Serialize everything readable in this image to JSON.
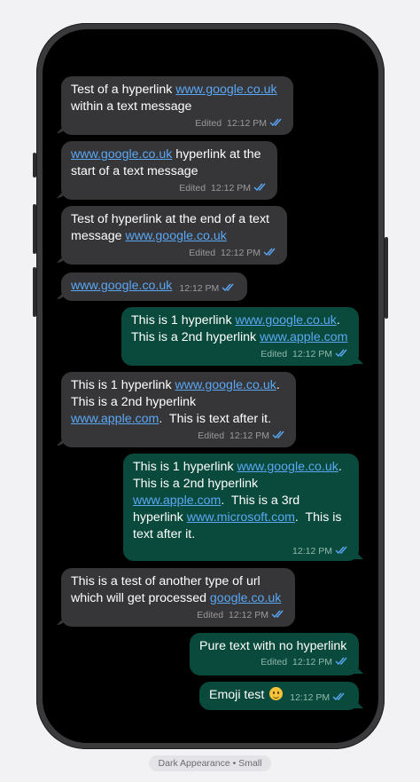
{
  "caption": "Dark Appearance • Small",
  "colors": {
    "incoming_bubble": "#363638",
    "outgoing_bubble": "#0a4a3c",
    "link": "#5aa7f5",
    "read_ticks": "#5aa7f5"
  },
  "messages": [
    {
      "direction": "incoming",
      "lines": [
        [
          "Test of a hyperlink ",
          "@www.google.co.uk"
        ],
        [
          "within a text message"
        ]
      ],
      "edited": "Edited",
      "time": "12:12 PM",
      "status_icon": "double-check-icon"
    },
    {
      "direction": "incoming",
      "lines": [
        [
          "@www.google.co.uk",
          " hyperlink at the"
        ],
        [
          "start of a text message"
        ]
      ],
      "edited": "Edited",
      "time": "12:12 PM",
      "status_icon": "double-check-icon"
    },
    {
      "direction": "incoming",
      "lines": [
        [
          "Test of hyperlink at the end of a text"
        ],
        [
          "message ",
          "@www.google.co.uk"
        ]
      ],
      "edited": "Edited",
      "time": "12:12 PM",
      "status_icon": "double-check-icon"
    },
    {
      "direction": "incoming",
      "lines": [
        [
          "@www.google.co.uk"
        ]
      ],
      "edited": "",
      "time": "12:12 PM",
      "status_icon": "double-check-icon"
    },
    {
      "direction": "outgoing",
      "lines": [
        [
          "This is 1 hyperlink ",
          "@www.google.co.uk",
          "."
        ],
        [
          "This is a 2nd hyperlink ",
          "@www.apple.com"
        ]
      ],
      "edited": "Edited",
      "time": "12:12 PM",
      "status_icon": "double-check-icon"
    },
    {
      "direction": "incoming",
      "lines": [
        [
          "This is 1 hyperlink ",
          "@www.google.co.uk",
          "."
        ],
        [
          "This is a 2nd hyperlink"
        ],
        [
          "@www.apple.com",
          ".  This is text after it."
        ]
      ],
      "edited": "Edited",
      "time": "12:12 PM",
      "status_icon": "double-check-icon"
    },
    {
      "direction": "outgoing",
      "lines": [
        [
          "This is 1 hyperlink ",
          "@www.google.co.uk",
          "."
        ],
        [
          "This is a 2nd hyperlink"
        ],
        [
          "@www.apple.com",
          ".  This is a 3rd"
        ],
        [
          "hyperlink ",
          "@www.microsoft.com",
          ".  This is"
        ],
        [
          "text after it."
        ]
      ],
      "edited": "",
      "time": "12:12 PM",
      "status_icon": "double-check-icon"
    },
    {
      "direction": "incoming",
      "lines": [
        [
          "This is a test of another type of url"
        ],
        [
          "which will get processed ",
          "@google.co.uk"
        ]
      ],
      "edited": "Edited",
      "time": "12:12 PM",
      "status_icon": "double-check-icon"
    },
    {
      "direction": "outgoing",
      "lines": [
        [
          "Pure text with no hyperlink"
        ]
      ],
      "edited": "Edited",
      "time": "12:12 PM",
      "status_icon": "double-check-icon"
    },
    {
      "direction": "outgoing",
      "lines": [
        [
          "Emoji test "
        ]
      ],
      "emoji": "slightly-smiling-face-emoji",
      "edited": "",
      "time": "12:12 PM",
      "status_icon": "double-check-icon"
    }
  ]
}
